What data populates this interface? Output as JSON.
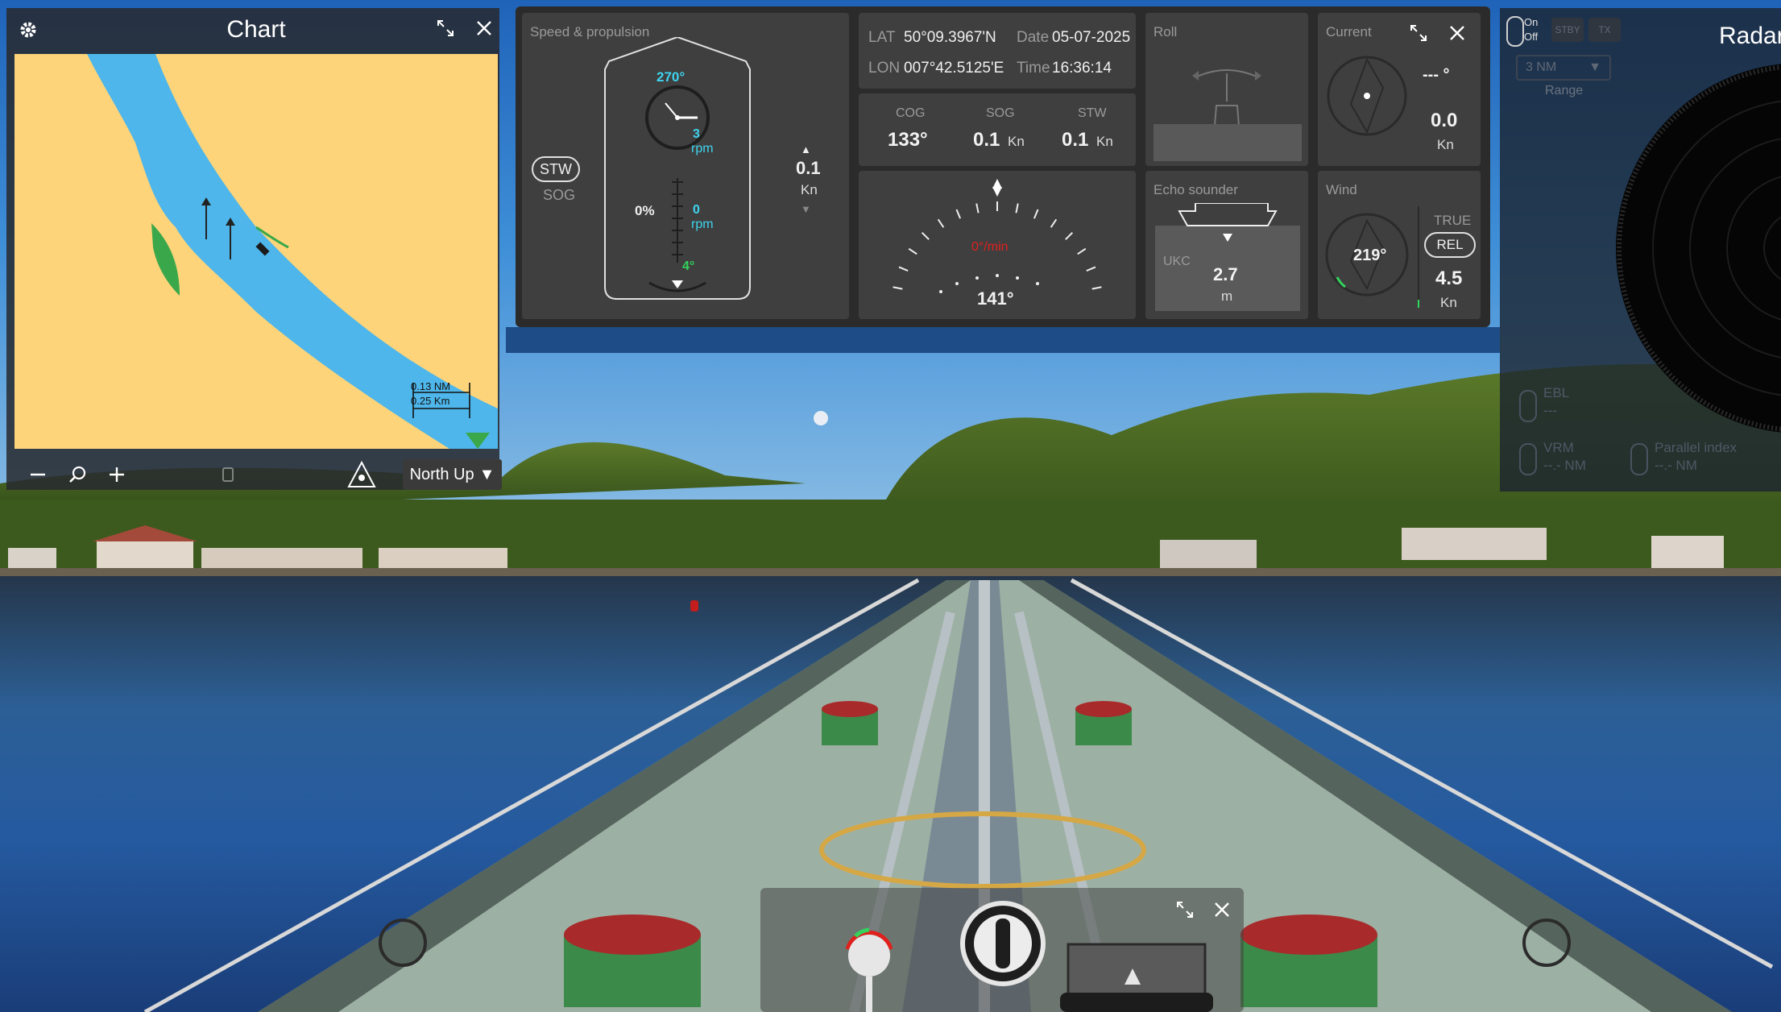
{
  "chart": {
    "title": "Chart",
    "scale_nm": "0.13 NM",
    "scale_km": "0.25 Km",
    "orientation": "North Up",
    "icons": {
      "settings": "gear-icon",
      "expand": "expand-icon",
      "close": "close-icon",
      "zoom_out": "minus-icon",
      "search": "search-icon",
      "zoom_in": "plus-icon",
      "center": "ship-center-icon"
    }
  },
  "speed_propulsion": {
    "label": "Speed & propulsion",
    "heading": "270°",
    "rpm_top_value": "3",
    "rpm_unit": "rpm",
    "throttle_pct": "0%",
    "rpm_bottom_value": "0",
    "rudder": "4°",
    "mode_selected": "STW",
    "mode_other": "SOG",
    "speed_value": "0.1",
    "speed_unit": "Kn"
  },
  "position": {
    "lat_label": "LAT",
    "lat": "50°09.3967'N",
    "lon_label": "LON",
    "lon": "007°42.5125'E",
    "date_label": "Date",
    "date": "05-07-2025",
    "time_label": "Time",
    "time": "16:36:14"
  },
  "motion": {
    "cog_label": "COG",
    "cog": "133°",
    "sog_label": "SOG",
    "sog": "0.1",
    "sog_unit": "Kn",
    "stw_label": "STW",
    "stw": "0.1",
    "stw_unit": "Kn"
  },
  "compass": {
    "heading": "141°",
    "rate_text": "0°/min"
  },
  "roll": {
    "label": "Roll"
  },
  "echo": {
    "label": "Echo sounder",
    "ukc_label": "UKC",
    "value": "2.7",
    "unit": "m"
  },
  "current": {
    "label": "Current",
    "direction": "--- °",
    "speed": "0.0",
    "unit": "Kn"
  },
  "wind": {
    "label": "Wind",
    "direction": "219°",
    "true_label": "TRUE",
    "rel_label": "REL",
    "speed": "4.5",
    "unit": "Kn"
  },
  "radar": {
    "title": "Radar",
    "power_on": "On",
    "power_off": "Off",
    "stby": "STBY",
    "tx": "TX",
    "range_value": "3 NM",
    "range_label": "Range",
    "ebl_label": "EBL",
    "ebl_value": "---",
    "vrm_label": "VRM",
    "vrm_value": "--.- NM",
    "pi_label": "Parallel index",
    "pi_value": "--.- NM"
  },
  "colors": {
    "land": "#fdd47a",
    "water": "#4eb6ea",
    "shoal": "#3aa84a",
    "accent_cyan": "#3ed4ef",
    "accent_green": "#33d45c",
    "warning_red": "#e0201c"
  }
}
